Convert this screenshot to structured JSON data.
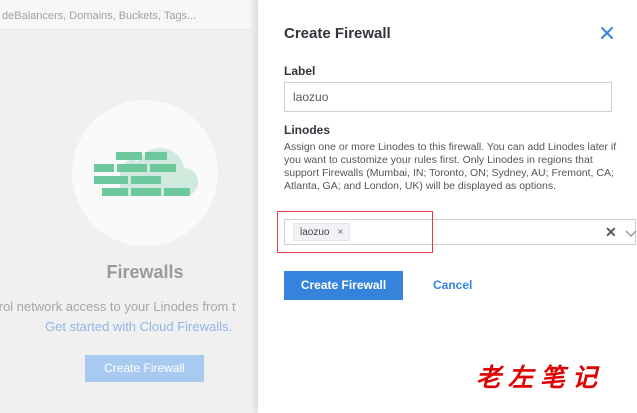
{
  "background": {
    "search_placeholder": "deBalancers, Domains, Buckets, Tags...",
    "title": "Firewalls",
    "subtitle": "trol network access to your Linodes from t",
    "link": "Get started with Cloud Firewalls.",
    "cta_label": "Create Firewall",
    "brand_colors": {
      "wall": "#6dc99d",
      "cta": "#a8c9f0",
      "link": "#8fb7e6"
    },
    "icon": "brick-wall-cloud-icon"
  },
  "drawer": {
    "title": "Create Firewall",
    "close_icon": "close-icon",
    "label_field": {
      "label": "Label",
      "value": "laozuo"
    },
    "linodes": {
      "label": "Linodes",
      "help": "Assign one or more Linodes to this firewall. You can add Linodes later if you want to customize your rules first. Only Linodes in regions that support Firewalls (Mumbai, IN; Toronto, ON; Sydney, AU; Fremont, CA; Atlanta, GA; and London, UK) will be displayed as options.",
      "selected": [
        {
          "label": "laozuo",
          "remove": "×"
        }
      ],
      "clear": "✕"
    },
    "buttons": {
      "primary": "Create Firewall",
      "cancel": "Cancel"
    },
    "accent": "#3683dc"
  },
  "watermark": {
    "text": "老左笔记"
  }
}
